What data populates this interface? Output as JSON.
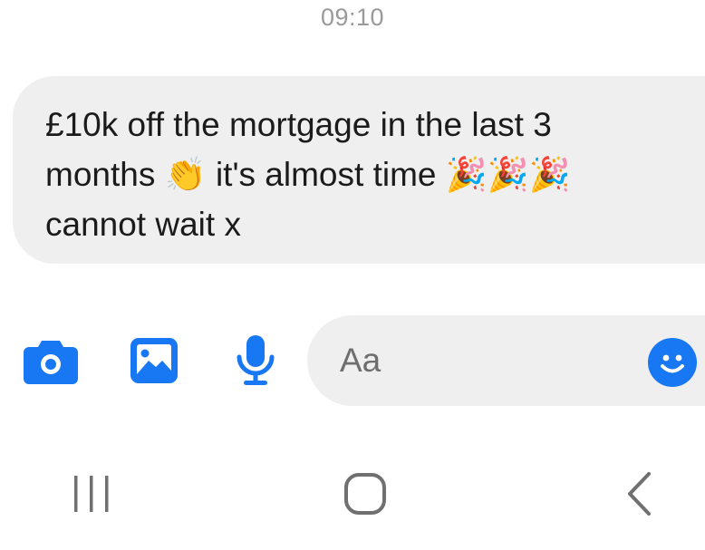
{
  "status": {
    "time": "09:10"
  },
  "message": {
    "text": "£10k off the mortgage in the last 3\nmonths 👏 it's almost time 🎉🎉🎉\ncannot wait x",
    "direction": "incoming"
  },
  "composer": {
    "placeholder": "Aa",
    "icons": [
      "camera-icon",
      "image-icon",
      "microphone-icon",
      "smiley-icon"
    ]
  },
  "navigation": {
    "icons": [
      "recent-apps-icon",
      "home-icon",
      "back-icon"
    ]
  },
  "colors": {
    "accent": "#1877f2",
    "bubble": "#efefef",
    "timestamp": "#9a9a9a",
    "nav_icons": "#707070"
  }
}
